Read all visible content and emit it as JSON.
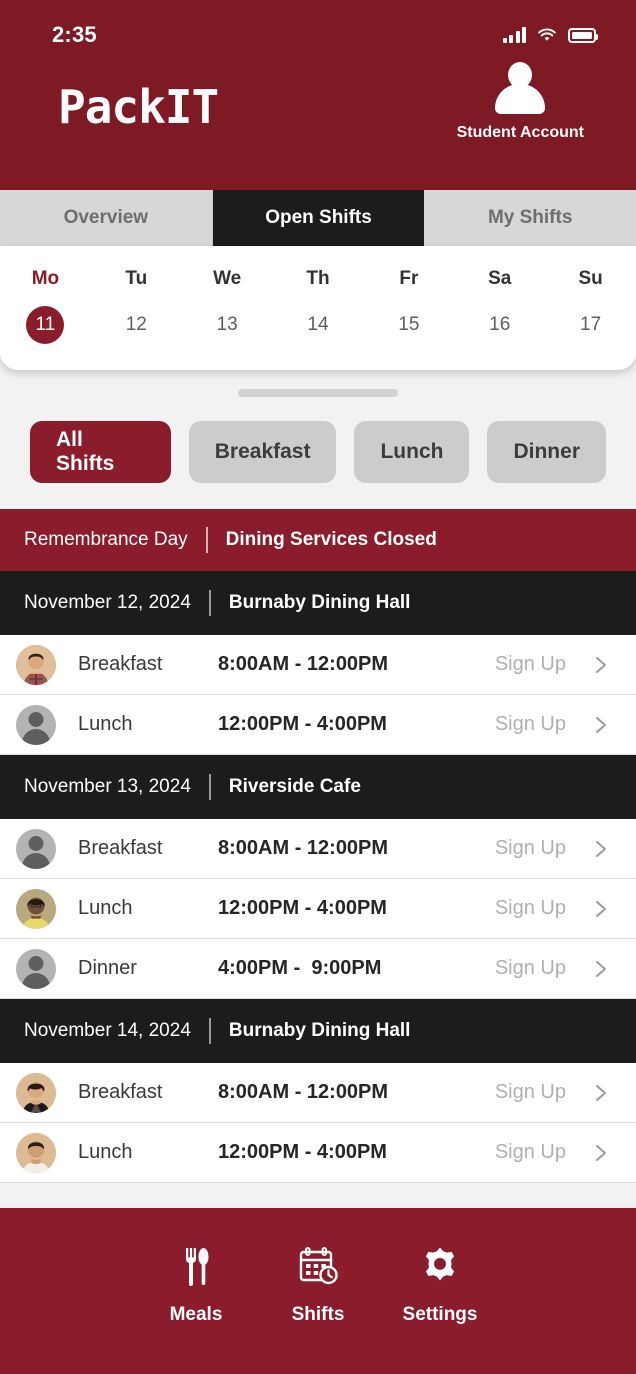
{
  "status_bar": {
    "time": "2:35",
    "signal_icon": "signal-bars-icon",
    "wifi_icon": "wifi-icon",
    "battery_icon": "battery-full-icon"
  },
  "header": {
    "app_name": "PackIT",
    "account_label": "Student Account",
    "bg_color": "#7e1a24"
  },
  "tabs": [
    {
      "label": "Overview",
      "active": false
    },
    {
      "label": "Open Shifts",
      "active": true
    },
    {
      "label": "My Shifts",
      "active": false
    }
  ],
  "calendar": {
    "days": [
      {
        "dow": "Mo",
        "num": "11",
        "selected": true
      },
      {
        "dow": "Tu",
        "num": "12",
        "selected": false
      },
      {
        "dow": "We",
        "num": "13",
        "selected": false
      },
      {
        "dow": "Th",
        "num": "14",
        "selected": false
      },
      {
        "dow": "Fr",
        "num": "15",
        "selected": false
      },
      {
        "dow": "Sa",
        "num": "16",
        "selected": false
      },
      {
        "dow": "Su",
        "num": "17",
        "selected": false
      }
    ]
  },
  "filters": [
    {
      "label": "All Shifts",
      "active": true
    },
    {
      "label": "Breakfast",
      "active": false
    },
    {
      "label": "Lunch",
      "active": false
    },
    {
      "label": "Dinner",
      "active": false
    }
  ],
  "banner": {
    "left": "Remembrance Day",
    "right": "Dining Services Closed",
    "color": "#8a1c2b"
  },
  "sections": [
    {
      "date": "November 12, 2024",
      "location": "Burnaby Dining Hall",
      "shifts": [
        {
          "meal": "Breakfast",
          "time": "8:00AM - 12:00PM",
          "action": "Sign Up",
          "avatar": "photo-plaid-shirt"
        },
        {
          "meal": "Lunch",
          "time": "12:00PM - 4:00PM",
          "action": "Sign Up",
          "avatar": "placeholder"
        }
      ]
    },
    {
      "date": "November 13, 2024",
      "location": "Riverside Cafe",
      "shifts": [
        {
          "meal": "Breakfast",
          "time": "8:00AM - 12:00PM",
          "action": "Sign Up",
          "avatar": "placeholder"
        },
        {
          "meal": "Lunch",
          "time": "12:00PM - 4:00PM",
          "action": "Sign Up",
          "avatar": "photo-yellow-shirt"
        },
        {
          "meal": "Dinner",
          "time": "4:00PM -  9:00PM",
          "action": "Sign Up",
          "avatar": "placeholder"
        }
      ]
    },
    {
      "date": "November 14, 2024",
      "location": "Burnaby Dining Hall",
      "shifts": [
        {
          "meal": "Breakfast",
          "time": "8:00AM - 12:00PM",
          "action": "Sign Up",
          "avatar": "photo-black-top"
        },
        {
          "meal": "Lunch",
          "time": "12:00PM - 4:00PM",
          "action": "Sign Up",
          "avatar": "photo-white-top"
        }
      ]
    }
  ],
  "bottom_nav": [
    {
      "label": "Meals",
      "icon": "fork-spoon-icon"
    },
    {
      "label": "Shifts",
      "icon": "calendar-clock-icon"
    },
    {
      "label": "Settings",
      "icon": "gear-icon"
    }
  ]
}
